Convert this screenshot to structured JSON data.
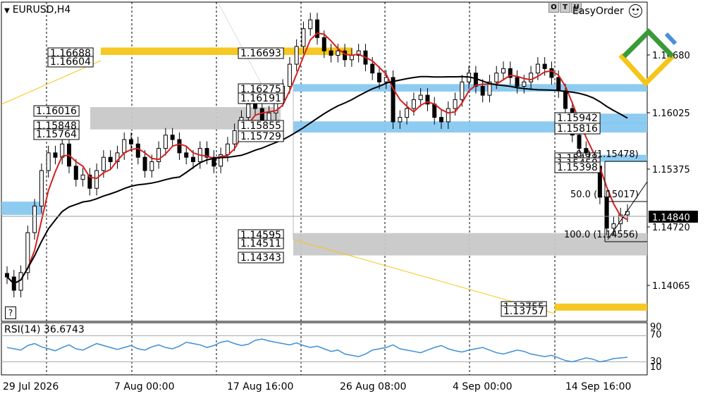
{
  "header": {
    "symbol": "EURUSD,H4",
    "dropdown_icon": "triangle-down-icon"
  },
  "toolbar": {
    "buttons": [
      "O",
      "T",
      "U"
    ],
    "easy_order": "EasyOrder",
    "smiley_icon": "smiley-face-icon",
    "help_label": "?"
  },
  "colors": {
    "candle": "#000000",
    "ma_fast": "#d61e1e",
    "ma_slow": "#000000",
    "rsi": "#3d8fd6",
    "zone_gold": "#f5c518",
    "zone_blue": "#88c8f0",
    "zone_gray": "#c8c8c8",
    "price_tag": "#000000"
  },
  "chart_data": [
    {
      "type": "candlestick",
      "symbol": "EURUSD",
      "timeframe": "H4",
      "y_ticks": [
        "1.16680",
        "1.16025",
        "1.15375",
        "1.14720",
        "1.14065"
      ],
      "x_ticks": [
        "29 Jul 2026",
        "7 Aug 00:00",
        "17 Aug 16:00",
        "26 Aug 08:00",
        "4 Sep 00:00",
        "14 Sep 16:00"
      ],
      "current_price": "1.14840",
      "ylim": [
        1.136,
        1.172
      ],
      "indicators": [
        "moving-average-fast",
        "moving-average-slow"
      ],
      "price_labels": [
        "1.16688",
        "1.16604",
        "1.16693",
        "1.16275",
        "1.16191",
        "1.16016",
        "1.15848",
        "1.15764",
        "1.15855",
        "1.15729",
        "1.15942",
        "1.15816",
        "1.15478",
        "1.15458",
        "1.15398",
        "1.14595",
        "1.14511",
        "1.14343",
        "1.13755",
        "1.13757"
      ],
      "fib_levels": [
        {
          "label": "0.0",
          "price": "1.15478"
        },
        {
          "label": "50.0",
          "price": "1.15017"
        },
        {
          "label": "100.0",
          "price": "1.14556"
        }
      ],
      "zones": [
        {
          "kind": "gold",
          "top": 1.16688,
          "bottom": 1.16604
        },
        {
          "kind": "blue",
          "top": 1.16275,
          "bottom": 1.16191
        },
        {
          "kind": "gray",
          "top": 1.16016,
          "bottom": 1.15764
        },
        {
          "kind": "blue",
          "top": 1.15855,
          "bottom": 1.15729
        },
        {
          "kind": "blue",
          "top": 1.15942,
          "bottom": 1.15816
        },
        {
          "kind": "blue",
          "top": 1.15478,
          "bottom": 1.15398
        },
        {
          "kind": "gray",
          "top": 1.14595,
          "bottom": 1.14343
        },
        {
          "kind": "blue",
          "top": 1.1495,
          "bottom": 1.148
        },
        {
          "kind": "gold",
          "top": 1.138,
          "bottom": 1.1372
        }
      ],
      "series": [
        {
          "values": [
            1.141,
            1.1395,
            1.1415,
            1.146,
            1.149,
            1.153,
            1.155,
            1.1545,
            1.156,
            1.1535,
            1.152,
            1.1525,
            1.151,
            1.153,
            1.1545,
            1.154,
            1.155,
            1.1565,
            1.156,
            1.1545,
            1.153,
            1.154,
            1.1555,
            1.157,
            1.1565,
            1.155,
            1.1545,
            1.154,
            1.1555,
            1.1545,
            1.1535,
            1.1548,
            1.156,
            1.1575,
            1.159,
            1.1605,
            1.16,
            1.1585,
            1.1595,
            1.161,
            1.1625,
            1.165,
            1.167,
            1.169,
            1.17,
            1.168,
            1.1665,
            1.166,
            1.1665,
            1.1655,
            1.166,
            1.1665,
            1.165,
            1.164,
            1.163,
            1.1635,
            1.1585,
            1.159,
            1.16,
            1.161,
            1.1615,
            1.1605,
            1.159,
            1.1585,
            1.16,
            1.161,
            1.163,
            1.164,
            1.1625,
            1.1615,
            1.163,
            1.164,
            1.1645,
            1.1635,
            1.1625,
            1.163,
            1.164,
            1.165,
            1.1645,
            1.1635,
            1.162,
            1.16,
            1.157,
            1.1555,
            1.1545,
            1.1535,
            1.15,
            1.1465,
            1.147,
            1.148,
            1.1484
          ]
        }
      ]
    },
    {
      "type": "line",
      "title": "RSI(14) 36.6743",
      "y_ticks": [
        "90",
        "70",
        "30",
        "10"
      ],
      "ylim": [
        10,
        90
      ],
      "series": [
        {
          "values": [
            52,
            50,
            48,
            55,
            58,
            53,
            50,
            47,
            52,
            56,
            50,
            48,
            53,
            58,
            55,
            52,
            49,
            52,
            55,
            50,
            48,
            53,
            56,
            52,
            50,
            54,
            60,
            58,
            56,
            52,
            55,
            60,
            62,
            58,
            55,
            57,
            63,
            65,
            62,
            60,
            58,
            56,
            59,
            55,
            52,
            54,
            50,
            46,
            48,
            42,
            40,
            38,
            42,
            48,
            50,
            52,
            56,
            50,
            48,
            46,
            44,
            48,
            52,
            55,
            50,
            47,
            45,
            48,
            50,
            52,
            48,
            44,
            42,
            45,
            48,
            46,
            42,
            40,
            38,
            40,
            36,
            32,
            30,
            33,
            36,
            34,
            30,
            32,
            35,
            36,
            37
          ]
        }
      ]
    }
  ]
}
